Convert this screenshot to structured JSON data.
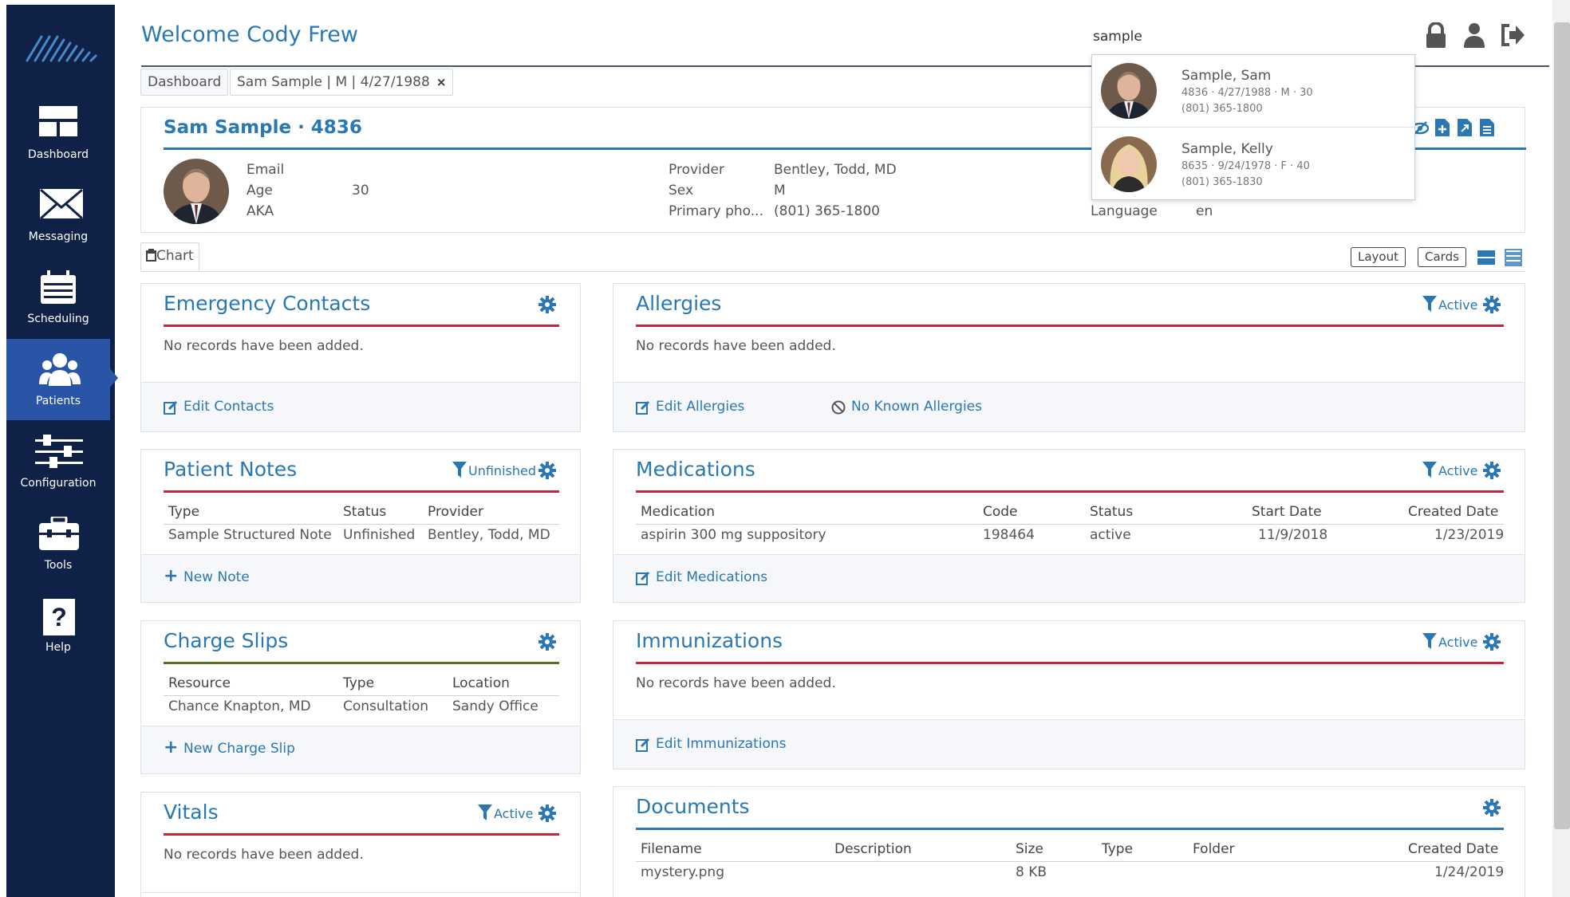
{
  "header": {
    "welcome": "Welcome Cody Frew",
    "search_value": "sample"
  },
  "nav": [
    {
      "label": "Dashboard",
      "icon": "dashboard-icon"
    },
    {
      "label": "Messaging",
      "icon": "envelope-icon"
    },
    {
      "label": "Scheduling",
      "icon": "calendar-icon"
    },
    {
      "label": "Patients",
      "icon": "users-icon",
      "active": true
    },
    {
      "label": "Configuration",
      "icon": "sliders-icon"
    },
    {
      "label": "Tools",
      "icon": "toolbox-icon"
    },
    {
      "label": "Help",
      "icon": "help-icon"
    }
  ],
  "tabs": {
    "dashboard": "Dashboard",
    "patient": "Sam Sample | M | 4/27/1988",
    "close": "×"
  },
  "patient": {
    "title": "Sam Sample · 4836",
    "email_label": "Email",
    "email": "",
    "age_label": "Age",
    "age": "30",
    "aka_label": "AKA",
    "aka": "",
    "provider_label": "Provider",
    "provider": "Bentley, Todd, MD",
    "sex_label": "Sex",
    "sex": "M",
    "phone_label": "Primary pho...",
    "phone": "(801) 365-1800",
    "language_label": "Language",
    "language": "en"
  },
  "chart_tab": "Chart",
  "view_buttons": {
    "layout": "Layout",
    "cards": "Cards"
  },
  "search_results": [
    {
      "name": "Sample, Sam",
      "meta": "4836 · 4/27/1988 · M · 30",
      "phone": "(801) 365-1800"
    },
    {
      "name": "Sample, Kelly",
      "meta": "8635 · 9/24/1978 · F · 40",
      "phone": "(801) 365-1830"
    }
  ],
  "emergency": {
    "title": "Emergency Contacts",
    "empty": "No records have been added.",
    "edit": "Edit Contacts"
  },
  "allergies": {
    "title": "Allergies",
    "filter": "Active",
    "empty": "No records have been added.",
    "edit": "Edit Allergies",
    "nka": "No Known Allergies"
  },
  "notes": {
    "title": "Patient Notes",
    "filter": "Unfinished",
    "headers": [
      "Type",
      "Status",
      "Provider"
    ],
    "row": [
      "Sample Structured Note",
      "Unfinished",
      "Bentley, Todd, MD"
    ],
    "new": "New Note"
  },
  "medications": {
    "title": "Medications",
    "filter": "Active",
    "headers": [
      "Medication",
      "Code",
      "Status",
      "Start Date",
      "Created Date"
    ],
    "row": [
      "aspirin 300 mg suppository",
      "198464",
      "active",
      "11/9/2018",
      "1/23/2019"
    ],
    "edit": "Edit Medications"
  },
  "charges": {
    "title": "Charge Slips",
    "headers": [
      "Resource",
      "Type",
      "Location"
    ],
    "row": [
      "Chance Knapton, MD",
      "Consultation",
      "Sandy Office"
    ],
    "new": "New Charge Slip"
  },
  "immunizations": {
    "title": "Immunizations",
    "filter": "Active",
    "empty": "No records have been added.",
    "edit": "Edit Immunizations"
  },
  "vitals": {
    "title": "Vitals",
    "filter": "Active",
    "empty": "No records have been added."
  },
  "documents": {
    "title": "Documents",
    "headers": [
      "Filename",
      "Description",
      "Size",
      "Type",
      "Folder",
      "Created Date"
    ],
    "row": [
      "mystery.png",
      "",
      "8 KB",
      "",
      "",
      "1/24/2019"
    ]
  },
  "colors": {
    "sidebar": "#0f2146",
    "active_nav": "#2a55a6",
    "accent": "#2878b4",
    "red_rule": "#c8243a",
    "green_rule": "#5a6e1e",
    "blue_rule": "#2a77b3"
  }
}
